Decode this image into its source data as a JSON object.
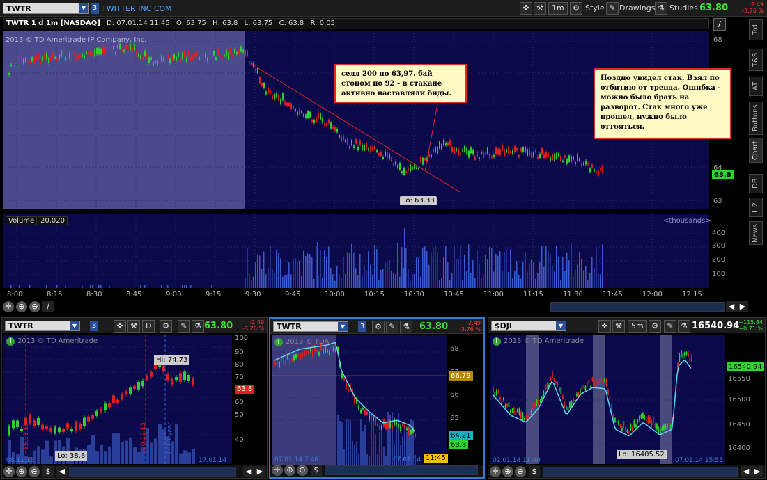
{
  "toolbar": {
    "symbol": "TWTR",
    "link": "3",
    "company": "TWITTER INC COM",
    "interval": "1m",
    "style_label": "Style",
    "drawings_label": "Drawings",
    "studies_label": "Studies",
    "last_price": "63.80",
    "change_abs": "-2.49",
    "change_pct": "-3.76 %"
  },
  "main_chart": {
    "header": {
      "title": "TWTR 1 d 1m [NASDAQ]",
      "date": "D: 07.01.14 11:45",
      "open": "O: 63.75",
      "high": "H: 63.8",
      "low": "L: 63.75",
      "close": "C: 63.8",
      "range": "R: 0.05"
    },
    "copyright": "2013 © TD Ameritrade IP Company, Inc.",
    "y_ticks": [
      "68",
      "64",
      "63"
    ],
    "price_badge": "63.8",
    "low_label": "Lo: 63.33",
    "volume_label": "Volume",
    "volume_value": "20,020",
    "volume_units": "<thousands>",
    "volume_ticks": [
      "400",
      "300",
      "200",
      "100"
    ],
    "time_ticks": [
      "8:00",
      "8:15",
      "8:30",
      "8:45",
      "9:00",
      "9:15",
      "9:30",
      "9:45",
      "10:00",
      "10:15",
      "10:30",
      "10:45",
      "11:00",
      "11:15",
      "11:30",
      "11:45",
      "12:00",
      "12:15"
    ]
  },
  "callouts": {
    "left": "селл 200 по 63,97. бай стопом по 92 - в стакане активно наставляли биды.",
    "right": "Поздно увидел стак. Взял по отбитию от тренда. Ошибка - можно было брать на разворот. Стак много уже прошел, нужно было оттояться."
  },
  "side_tabs": [
    "Trd",
    "T&S",
    "AT",
    "Buttons",
    "Chart",
    "DB",
    "L 2",
    "News"
  ],
  "active_tab": "Chart",
  "panel1": {
    "symbol": "TWTR",
    "link": "3",
    "interval": "D",
    "price": "63.80",
    "change_abs": "-2.49",
    "change_pct": "-3.76 %",
    "info": "2013 © TD Ameritrade",
    "y_ticks": [
      "100",
      "90",
      "80",
      "70",
      "60",
      "50",
      "40"
    ],
    "price_badge": "63.8",
    "hi_label": "Hi: 74.73",
    "lo_label": "Lo: 38.8",
    "vlabels": [
      "15.11.13",
      "20.12.13",
      "2013 year"
    ],
    "date_left": "08.11.13",
    "date_right": "17.01.14"
  },
  "panel2": {
    "symbol": "TWTR",
    "link": "3",
    "price": "63.80",
    "change_abs": "-2.49",
    "change_pct": "-3.76 %",
    "info": "2013 © TDA",
    "y_ticks": [
      "68",
      "67",
      "66",
      "65",
      "64"
    ],
    "badge_top": "66.79",
    "badge_mid": "64.21",
    "badge_price": "63.8",
    "badge_time": "11:45",
    "date_left": "07.01.14 7:46",
    "date_right": "07.01.14"
  },
  "panel3": {
    "symbol": "$DJI",
    "interval": "5m",
    "price": "16540.94",
    "change_abs": "+115.84",
    "change_pct": "+0.71 %",
    "info": "2013 © TD Ameritrade",
    "y_ticks": [
      "16550",
      "16500",
      "16450",
      "16400"
    ],
    "price_badge": "16540.94",
    "lo_label": "Lo: 16405.52",
    "date_left": "02.01.14 11:40",
    "date_right": "07.01.14 15:55"
  },
  "colors": {
    "chart_bg": "#0a0a4a",
    "premarket_bg": "#4a4a8c",
    "up": "#2fd02f",
    "down": "#e02020",
    "trendline": "#e02020",
    "volume": "#3a5bd0",
    "price_green": "#3be03b",
    "change_red": "#ff3b3b",
    "accent_blue": "#2d7fd4"
  }
}
